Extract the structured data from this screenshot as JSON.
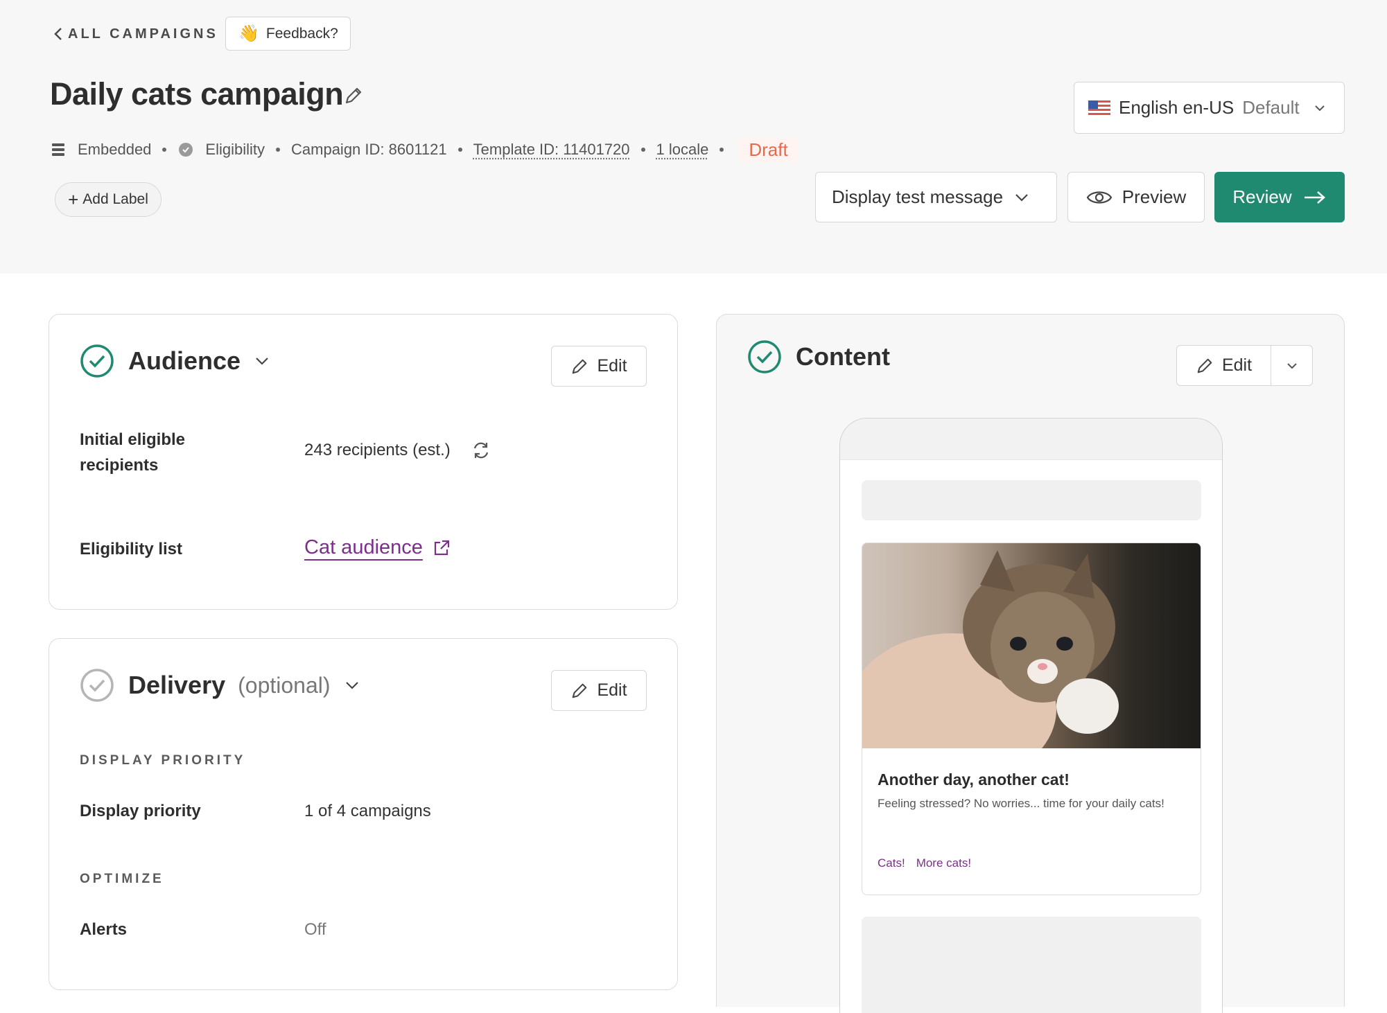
{
  "header": {
    "back_label": "ALL CAMPAIGNS",
    "feedback_label": "Feedback?",
    "title": "Daily cats campaign",
    "locale": {
      "name": "English en-US",
      "tag": "Default"
    },
    "meta": {
      "channel": "Embedded",
      "type": "Eligibility",
      "campaign_id": "Campaign ID: 8601121",
      "template_id": "Template ID: 11401720",
      "locales": "1 locale",
      "status": "Draft"
    },
    "add_label": "Add Label",
    "test_message_label": "Display test message",
    "preview_label": "Preview",
    "review_label": "Review"
  },
  "audience": {
    "title": "Audience",
    "edit_label": "Edit",
    "rows": [
      {
        "label": "Initial eligible recipients",
        "value": "243 recipients (est.)"
      },
      {
        "label": "Eligibility list",
        "value": "Cat audience"
      }
    ]
  },
  "delivery": {
    "title": "Delivery",
    "optional": "(optional)",
    "edit_label": "Edit",
    "display_priority_caption": "DISPLAY PRIORITY",
    "display_priority_label": "Display priority",
    "display_priority_value": "1 of 4 campaigns",
    "optimize_caption": "OPTIMIZE",
    "alerts_label": "Alerts",
    "alerts_value": "Off"
  },
  "content": {
    "title": "Content",
    "edit_label": "Edit",
    "message": {
      "title": "Another day, another cat!",
      "body": "Feeling stressed? No worries... time for your daily cats!",
      "link1": "Cats!",
      "link2": "More cats!"
    }
  },
  "colors": {
    "accent": "#1f8a70",
    "link": "#7b2f8a",
    "draft": "#e8684a"
  }
}
